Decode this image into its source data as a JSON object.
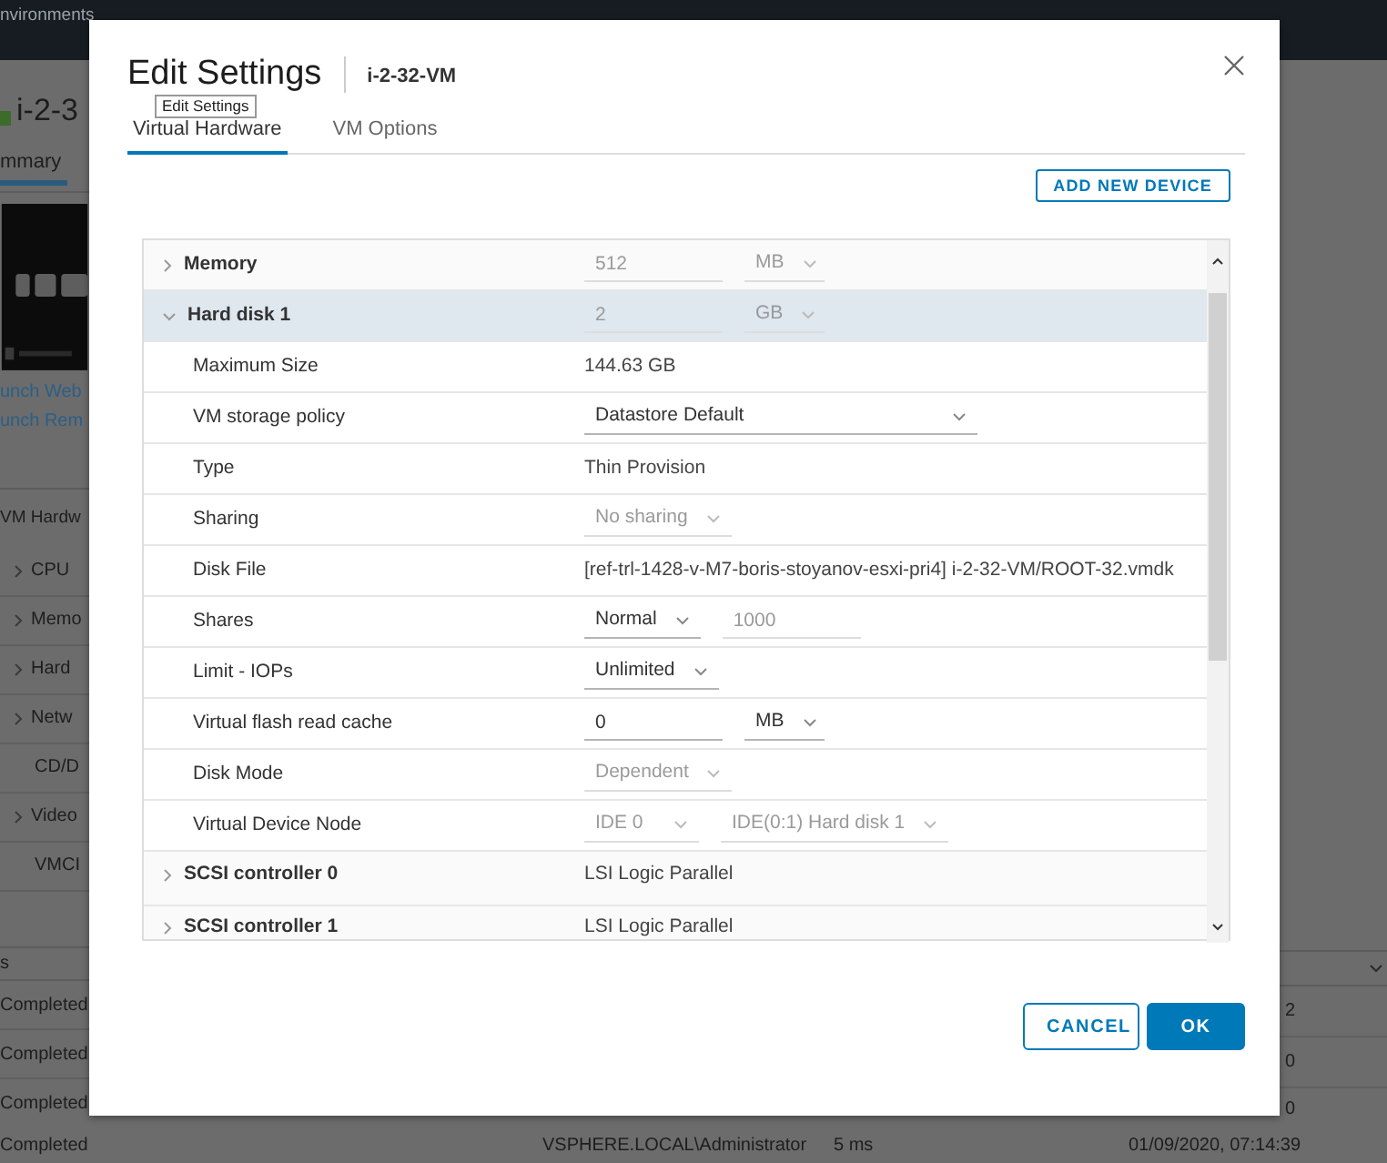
{
  "background": {
    "top_bar_text": "nvironments",
    "vm_title": "i-2-3",
    "tab": {
      "label": "mmary",
      "selected": true
    },
    "links": [
      "unch Web",
      "unch Rem"
    ],
    "hardware_header": "VM Hardw",
    "hardware_rows": [
      {
        "label": "CPU",
        "expandable": true
      },
      {
        "label": "Memo",
        "expandable": true
      },
      {
        "label": "Hard",
        "expandable": true
      },
      {
        "label": "Netw",
        "expandable": true
      },
      {
        "label": "CD/D",
        "expandable": false
      },
      {
        "label": "Video",
        "expandable": true
      },
      {
        "label": "VMCI",
        "expandable": false
      }
    ],
    "tasks_header": "s",
    "task_rows": [
      {
        "status": "Completed",
        "column_2": "2"
      },
      {
        "status": "Completed",
        "column_2": "0"
      },
      {
        "status": "Completed",
        "column_2": "0"
      }
    ],
    "last_row": {
      "status": "Completed",
      "initiator": "VSPHERE.LOCAL\\Administrator",
      "queued_for": "5 ms",
      "completion_time": "01/09/2020, 07:14:39"
    }
  },
  "dialog": {
    "title": "Edit Settings",
    "subtitle": "i-2-32-VM",
    "tooltip": "Edit Settings",
    "tabs": [
      {
        "label": "Virtual Hardware",
        "selected": true
      },
      {
        "label": "VM Options",
        "selected": false
      }
    ],
    "add_button": "ADD NEW DEVICE",
    "devices": [
      {
        "label": "Memory",
        "expanded": false,
        "selected": false,
        "controls": [
          {
            "kind": "field",
            "value": "512",
            "disabled": true
          },
          {
            "kind": "unit",
            "value": "MB",
            "disabled": true
          }
        ]
      },
      {
        "label": "Hard disk 1",
        "expanded": true,
        "selected": true,
        "controls": [
          {
            "kind": "field",
            "value": "2",
            "disabled": true
          },
          {
            "kind": "unit",
            "value": "GB",
            "disabled": true
          }
        ],
        "children": [
          {
            "label": "Maximum Size",
            "controls": [
              {
                "kind": "text",
                "value": "144.63 GB"
              }
            ]
          },
          {
            "label": "VM storage policy",
            "controls": [
              {
                "kind": "dropdown",
                "value": "Datastore Default",
                "disabled": false
              }
            ]
          },
          {
            "label": "Type",
            "controls": [
              {
                "kind": "text",
                "value": "Thin Provision"
              }
            ]
          },
          {
            "label": "Sharing",
            "controls": [
              {
                "kind": "dropdown",
                "value": "No sharing",
                "disabled": true
              }
            ]
          },
          {
            "label": "Disk File",
            "controls": [
              {
                "kind": "text",
                "value": "[ref-trl-1428-v-M7-boris-stoyanov-esxi-pri4] i-2-32-VM/ROOT-32.vmdk"
              }
            ]
          },
          {
            "label": "Shares",
            "controls": [
              {
                "kind": "dropdown",
                "value": "Normal",
                "disabled": false
              },
              {
                "kind": "field",
                "value": "1000",
                "disabled": true
              }
            ]
          },
          {
            "label": "Limit - IOPs",
            "controls": [
              {
                "kind": "dropdown",
                "value": "Unlimited",
                "disabled": false
              }
            ]
          },
          {
            "label": "Virtual flash read cache",
            "controls": [
              {
                "kind": "field",
                "value": "0",
                "disabled": false
              },
              {
                "kind": "unit",
                "value": "MB",
                "disabled": false
              }
            ]
          },
          {
            "label": "Disk Mode",
            "controls": [
              {
                "kind": "dropdown",
                "value": "Dependent",
                "disabled": true
              }
            ]
          },
          {
            "label": "Virtual Device Node",
            "controls": [
              {
                "kind": "dropdown",
                "value": "IDE 0",
                "disabled": true
              },
              {
                "kind": "dropdown",
                "value": "IDE(0:1) Hard disk 1",
                "disabled": true
              }
            ]
          }
        ]
      },
      {
        "label": "SCSI controller 0",
        "expanded": false,
        "selected": false,
        "controls": [
          {
            "kind": "text",
            "value": "LSI Logic Parallel"
          }
        ]
      },
      {
        "label": "SCSI controller 1",
        "expanded": false,
        "selected": false,
        "controls": [
          {
            "kind": "text",
            "value": "LSI Logic Parallel"
          }
        ]
      }
    ],
    "buttons": [
      {
        "label": "CANCEL",
        "kind": "secondary"
      },
      {
        "label": "OK",
        "kind": "primary"
      }
    ]
  }
}
